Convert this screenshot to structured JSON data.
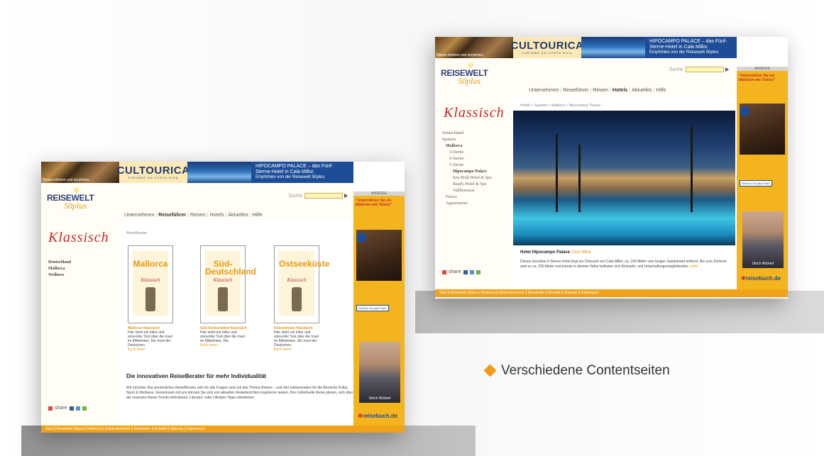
{
  "banner": {
    "photo_caption": "Neues erleben und verstehen.",
    "cultourica_logo": "CULTOURICA",
    "cultourica_sub": "TURISMO EN COSTA RICA",
    "hotel_ad_line1": "HIPOCAMPO PALACE – das Fünf-",
    "hotel_ad_line2": "Sterne-Hotel in Cala Millor.",
    "hotel_ad_line3": "Empfohlen von der Reisewelt 50plus"
  },
  "logo": {
    "reisewelt": "REISEWELT",
    "fiftyplus": "50plus"
  },
  "search": {
    "label": "Suche"
  },
  "nav": {
    "items": [
      {
        "label": "Unternehmen",
        "active": false
      },
      {
        "label": "Reiseführer",
        "active": true
      },
      {
        "label": "Reisen",
        "active": false
      },
      {
        "label": "Hotels",
        "active": false
      },
      {
        "label": "Aktuelles",
        "active": false
      },
      {
        "label": "Hilfe",
        "active": false
      }
    ],
    "items_page2": [
      {
        "label": "Unternehmen",
        "active": false
      },
      {
        "label": "Reiseführer",
        "active": false
      },
      {
        "label": "Reisen",
        "active": false
      },
      {
        "label": "Hotels",
        "active": true
      },
      {
        "label": "Aktuelles",
        "active": false
      },
      {
        "label": "Hilfe",
        "active": false
      }
    ]
  },
  "sidebar": {
    "brand": "Klassisch",
    "page1_items": [
      "Deutschland",
      "Mallorca",
      "Wellness"
    ],
    "page2_items": [
      {
        "label": "Deutschland",
        "bold": false,
        "indent": 0
      },
      {
        "label": "Spanien",
        "bold": false,
        "indent": 0
      },
      {
        "label": "Mallorca",
        "bold": true,
        "indent": 1
      },
      {
        "label": "3-Sterne",
        "bold": false,
        "indent": 2
      },
      {
        "label": "4-Sterne",
        "bold": false,
        "indent": 2
      },
      {
        "label": "5-Sterne",
        "bold": false,
        "indent": 2
      },
      {
        "label": "Hipocampo Palace",
        "bold": true,
        "indent": 3
      },
      {
        "label": "Son Brull Hotel & Spa",
        "bold": false,
        "indent": 3
      },
      {
        "label": "Read's Hotel & Spa",
        "bold": false,
        "indent": 3
      },
      {
        "label": "Valldemossa",
        "bold": false,
        "indent": 3
      },
      {
        "label": "Fincas",
        "bold": false,
        "indent": 1
      },
      {
        "label": "Appartments",
        "bold": false,
        "indent": 1
      }
    ],
    "share_label": "share"
  },
  "ads": {
    "header": "ANZEIGE",
    "plan_text": "\"Unterstützen Sie ein Mädchen wie Tahira!\"",
    "plan_logo": "Plan",
    "werden_button": "Werden Sie jetzt Pate!",
    "person_name": "Ulrich Wickert",
    "reisebuch": "reisebuch.de"
  },
  "page1": {
    "breadcrumb": "ReiseBerater",
    "books": [
      {
        "cover": "Mallorca",
        "cover_color": "#e59a12",
        "title": "Mallorca Klassisch",
        "text": "Hier steht ein toller und sinnvoller Text über die Insel im Mittelmeer. Die Insel der Deutschen.",
        "link": "Buch lesen"
      },
      {
        "cover": "Süd-Deutschland",
        "cover_color": "#e59a12",
        "title": "Süd-Deutschland Klassisch",
        "text": "Hier steht ein toller und sinnvoller Text über die Insel im Mittelmeer. Die",
        "link": "Buch lesen"
      },
      {
        "cover": "Ostseeküste",
        "cover_color": "#e59a12",
        "title": "Ostseeküste Klassisch",
        "text": "Hier steht ein toller und sinnvoller Text über die Insel im Mittelmeer. Die Insel der Deutschen.",
        "link": "Buch lesen"
      }
    ],
    "section_heading": "Die innovativen ReiseBerater für mehr Individualität",
    "section_text": "Wir möchten Ihre persönlichen ReiseBerater sein für alle Fragen rund um das Thema Reisen – und dort insbesondere für die Bereiche Kultur, Sport & Wellness. Gemeinsam mit uns können Sie sich von aktuellen Reiseberichten inspirieren lassen, Ihre individuelle Reise planen, sich über die neuesten Reise-Trends informieren, Literatur- oder Lifestyle-Tipps mitnehmen."
  },
  "page2": {
    "breadcrumb": "Hotels > Spanien > Mallorca > Hipocampus Palace",
    "hotel_name": "Hotel Hipocampo Palace",
    "hotel_location": "Cala Millor",
    "hotel_text": "Dieses luxuriöse 5-Sterne-Hotel liegt am Ortsrand von Cala Millor, ca. 150 Meter vom langen Sandstrand entfernt. Bis zum Zentrum sind es ca. 250 Meter und bereits in direkter Nähe befinden sich Einkaufs- und Unterhaltungsmöglichkeiten.",
    "more_link": "mehr"
  },
  "footer": {
    "links": "Start  ||  Reisewelt 50plus  ||  Mallorca  ||  Süddeutschland  ||  Newsletter  ||  Kontakt  ||  Sitemap  ||  Impressum"
  },
  "caption": {
    "text": "Verschiedene Contentseiten"
  },
  "colors": {
    "accent": "#f2a11b",
    "brand_blue": "#2d3f7a",
    "klassisch_red": "#c62828"
  }
}
